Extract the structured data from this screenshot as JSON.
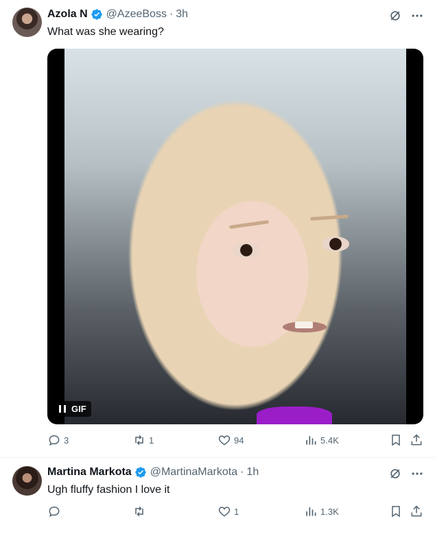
{
  "tweets": [
    {
      "author_name": "Azola N",
      "handle": "@AzeeBoss",
      "separator": "·",
      "time": "3h",
      "text": "What was she wearing?",
      "media": {
        "type": "gif",
        "badge_label": "GIF"
      },
      "replies": "3",
      "reposts": "1",
      "likes": "94",
      "views": "5.4K"
    },
    {
      "author_name": "Martina Markota",
      "handle": "@MartinaMarkota",
      "separator": "·",
      "time": "1h",
      "text": "Ugh fluffy fashion I love it",
      "replies": "",
      "reposts": "",
      "likes": "1",
      "views": "1.3K"
    }
  ],
  "icons": {
    "verified": "verified-badge-icon",
    "grok": "grok-icon",
    "more": "more-icon",
    "reply": "reply-icon",
    "repost": "repost-icon",
    "like": "heart-icon",
    "views": "views-icon",
    "bookmark": "bookmark-icon",
    "share": "share-icon",
    "pause": "pause-icon"
  },
  "colors": {
    "text": "#0f1419",
    "secondary": "#536471",
    "verified": "#1d9bf0",
    "divider": "#eff3f4"
  }
}
